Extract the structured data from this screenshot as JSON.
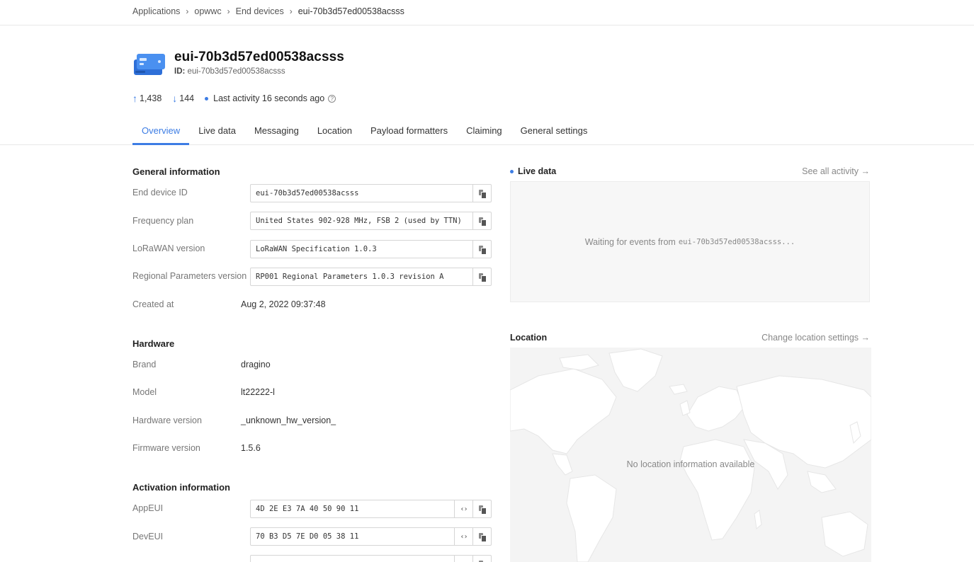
{
  "breadcrumb": {
    "items": [
      "Applications",
      "opwwc",
      "End devices"
    ],
    "current": "eui-70b3d57ed00538acsss"
  },
  "device": {
    "title": "eui-70b3d57ed00538acsss",
    "id_label": "ID:",
    "id_value": "eui-70b3d57ed00538acsss",
    "icon": "device-hardware-icon"
  },
  "stats": {
    "uplink": "1,438",
    "downlink": "144",
    "last_activity": "Last activity 16 seconds ago"
  },
  "tabs": [
    "Overview",
    "Live data",
    "Messaging",
    "Location",
    "Payload formatters",
    "Claiming",
    "General settings"
  ],
  "general": {
    "title": "General information",
    "end_device_id": {
      "label": "End device ID",
      "value": "eui-70b3d57ed00538acsss"
    },
    "frequency_plan": {
      "label": "Frequency plan",
      "value": "United States 902-928 MHz, FSB 2 (used by TTN)"
    },
    "lorawan_version": {
      "label": "LoRaWAN version",
      "value": "LoRaWAN Specification 1.0.3"
    },
    "regional_params": {
      "label": "Regional Parameters version",
      "value": "RP001 Regional Parameters 1.0.3 revision A"
    },
    "created_at": {
      "label": "Created at",
      "value": "Aug 2, 2022 09:37:48"
    }
  },
  "hardware": {
    "title": "Hardware",
    "brand": {
      "label": "Brand",
      "value": "dragino"
    },
    "model": {
      "label": "Model",
      "value": "lt22222-l"
    },
    "hw_version": {
      "label": "Hardware version",
      "value": "_unknown_hw_version_"
    },
    "fw_version": {
      "label": "Firmware version",
      "value": "1.5.6"
    }
  },
  "activation": {
    "title": "Activation information",
    "appeui": {
      "label": "AppEUI",
      "value": "4D 2E E3 7A 40 50 90 11"
    },
    "deveui": {
      "label": "DevEUI",
      "value": "70 B3 D5 7E D0 05 38 11"
    }
  },
  "live_data": {
    "title": "Live data",
    "link": "See all activity →",
    "waiting_text": "Waiting for events from",
    "waiting_device": "eui-70b3d57ed00538acsss..."
  },
  "location": {
    "title": "Location",
    "link": "Change location settings →",
    "empty_text": "No location information available"
  },
  "colors": {
    "accent": "#3d7de4",
    "muted": "#888888",
    "border": "#d6d6d6"
  }
}
